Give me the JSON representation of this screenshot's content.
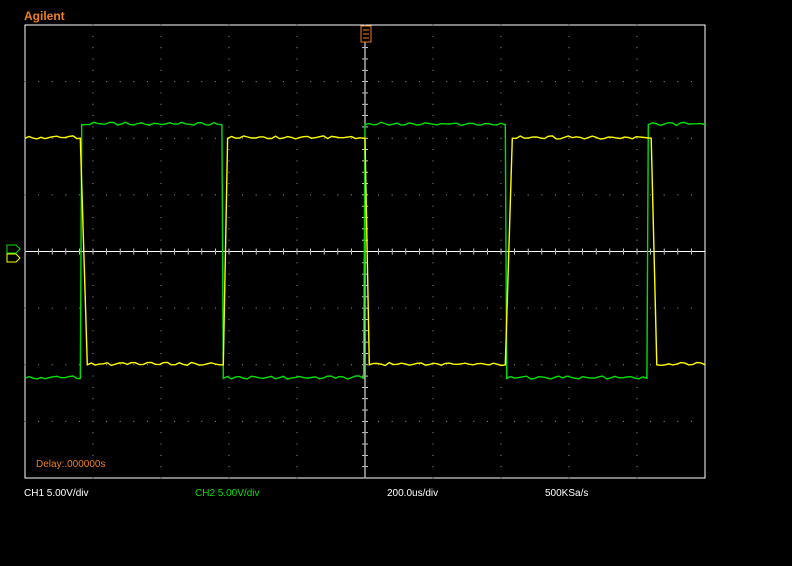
{
  "brand": "Agilent",
  "delay_text": "Delay:.000000s",
  "status": {
    "ch1": "CH1 5.00V/div",
    "ch2": "CH2 5.00V/div",
    "timebase": "200.0us/div",
    "sample_rate": "500KSa/s"
  },
  "colors": {
    "ch1": "#ffff00",
    "ch2": "#00e000",
    "grid": "#ffffff",
    "brand": "#f07d1e",
    "status_text": "#ffffff"
  },
  "chart_data": {
    "type": "line",
    "title": "",
    "xlabel": "",
    "ylabel": "",
    "x_unit": "us",
    "y_unit": "V",
    "xlim": [
      0,
      2400
    ],
    "ylim": [
      -20,
      20
    ],
    "grid": true,
    "series": [
      {
        "name": "CH1",
        "x": [
          0,
          195,
          220,
          700,
          715,
          1200,
          1215,
          1695,
          1720,
          2210,
          2230,
          2400
        ],
        "y": [
          10,
          10,
          -10,
          -10,
          10,
          10,
          -10,
          -10,
          10,
          10,
          -10,
          -10
        ]
      },
      {
        "name": "CH2",
        "x": [
          0,
          195,
          200,
          695,
          700,
          1195,
          1200,
          1695,
          1700,
          2195,
          2200,
          2400
        ],
        "y": [
          -11.2,
          -11.2,
          11.2,
          11.2,
          -11.2,
          -11.2,
          11.2,
          11.2,
          -11.2,
          -11.2,
          11.2,
          11.2
        ]
      }
    ]
  }
}
